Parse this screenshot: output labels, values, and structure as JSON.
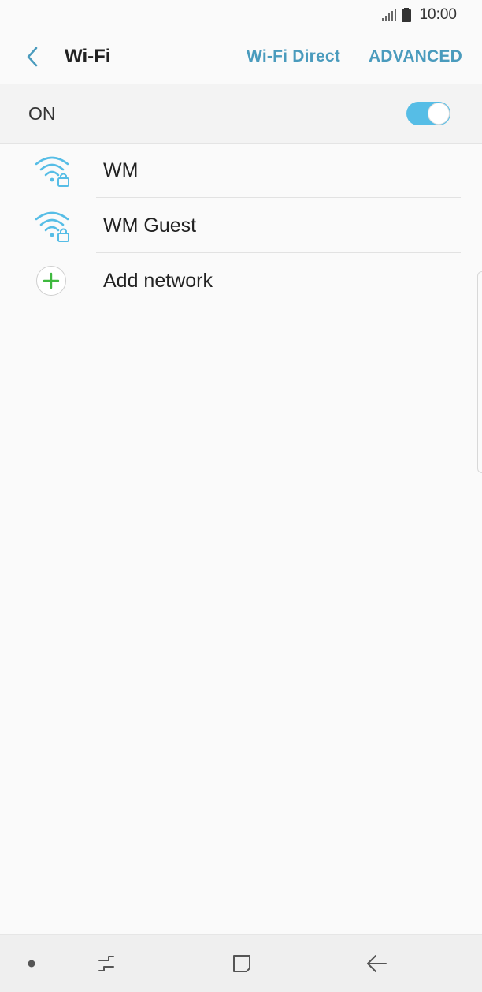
{
  "status_bar": {
    "time": "10:00",
    "icons": [
      "signal-icon",
      "battery-icon"
    ]
  },
  "app_bar": {
    "title": "Wi-Fi",
    "back_icon": "chevron-left-icon",
    "actions": {
      "wifi_direct": "Wi-Fi Direct",
      "advanced": "ADVANCED"
    }
  },
  "master_switch": {
    "label": "ON",
    "state": true
  },
  "networks": [
    {
      "name": "WM",
      "icon": "wifi-locked-icon"
    },
    {
      "name": "WM Guest",
      "icon": "wifi-locked-icon"
    }
  ],
  "add_network": {
    "label": "Add network",
    "icon": "plus-circle-icon"
  },
  "nav_bar": {
    "icons": [
      "dot-icon",
      "recents-icon",
      "home-icon",
      "back-arrow-icon"
    ]
  },
  "colors": {
    "accent": "#4a9bbd",
    "toggle_on": "#56bde6",
    "wifi_icon": "#56bde6",
    "add_icon": "#3fb93f",
    "background": "#fafafa"
  }
}
